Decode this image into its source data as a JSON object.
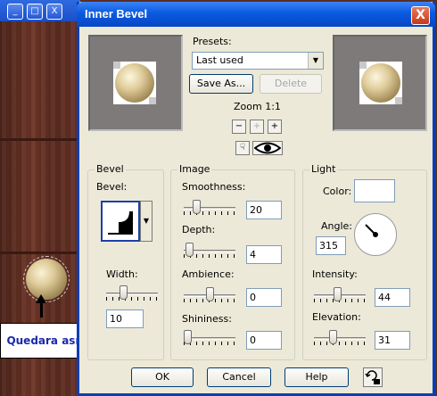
{
  "background": {
    "caption": "Quedara así",
    "window_buttons": [
      "_",
      "□",
      "X"
    ]
  },
  "dialog": {
    "title": "Inner Bevel",
    "close": "X",
    "presets": {
      "label": "Presets:",
      "value": "Last used",
      "save_as": "Save As...",
      "delete": "Delete"
    },
    "zoom": {
      "label": "Zoom 1:1"
    },
    "bevel": {
      "group": "Bevel",
      "bevel_label": "Bevel:",
      "width_label": "Width:",
      "width_value": "10",
      "width_level": 0.3
    },
    "image": {
      "group": "Image",
      "smoothness_label": "Smoothness:",
      "smoothness_value": "20",
      "smoothness_level": 0.2,
      "depth_label": "Depth:",
      "depth_value": "4",
      "depth_level": 0.05,
      "ambience_label": "Ambience:",
      "ambience_value": "0",
      "ambience_level": 0.5,
      "shininess_label": "Shininess:",
      "shininess_value": "0",
      "shininess_level": 0.0
    },
    "light": {
      "group": "Light",
      "color_label": "Color:",
      "color": "#ffffff",
      "angle_label": "Angle:",
      "angle_value": "315",
      "intensity_label": "Intensity:",
      "intensity_value": "44",
      "intensity_level": 0.44,
      "elevation_label": "Elevation:",
      "elevation_value": "31",
      "elevation_level": 0.35
    },
    "buttons": {
      "ok": "OK",
      "cancel": "Cancel",
      "help": "Help"
    }
  }
}
